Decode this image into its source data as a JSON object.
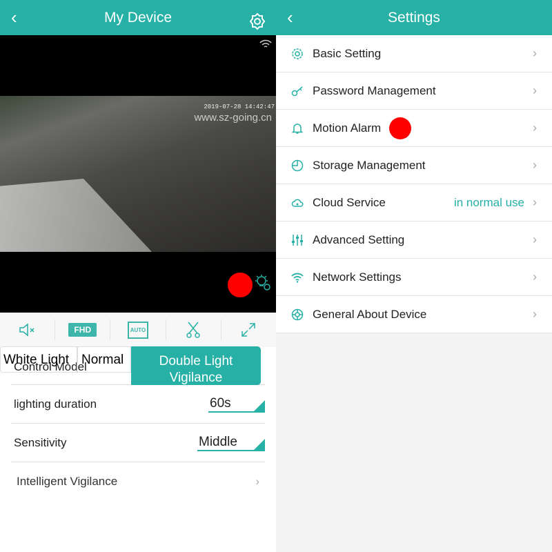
{
  "left": {
    "title": "My Device",
    "timestamp": "2019-07-28 14:42:47",
    "watermark": "www.sz-going.cn",
    "toolbar": {
      "fhd": "FHD",
      "auto": "AUTO"
    },
    "control_model": {
      "label": "Control Model",
      "options": [
        "White Light",
        "Normal",
        "Double Light Vigilance"
      ],
      "selected": "Double Light Vigilance"
    },
    "lighting_duration": {
      "label": "lighting duration",
      "value": "60s"
    },
    "sensitivity": {
      "label": "Sensitivity",
      "value": "Middle"
    },
    "intelligent": {
      "label": "Intelligent Vigilance"
    }
  },
  "right": {
    "title": "Settings",
    "items": [
      {
        "label": "Basic Setting",
        "icon": "gear-icon"
      },
      {
        "label": "Password Management",
        "icon": "key-icon"
      },
      {
        "label": "Motion Alarm",
        "icon": "bell-icon"
      },
      {
        "label": "Storage Management",
        "icon": "pie-icon"
      },
      {
        "label": "Cloud Service",
        "icon": "cloud-icon",
        "value": "in normal use"
      },
      {
        "label": "Advanced Setting",
        "icon": "sliders-icon"
      },
      {
        "label": "Network Settings",
        "icon": "wifi-icon"
      },
      {
        "label": "General About Device",
        "icon": "lifebuoy-icon"
      }
    ]
  },
  "colors": {
    "accent": "#26b0a6",
    "record": "#ff0000"
  }
}
